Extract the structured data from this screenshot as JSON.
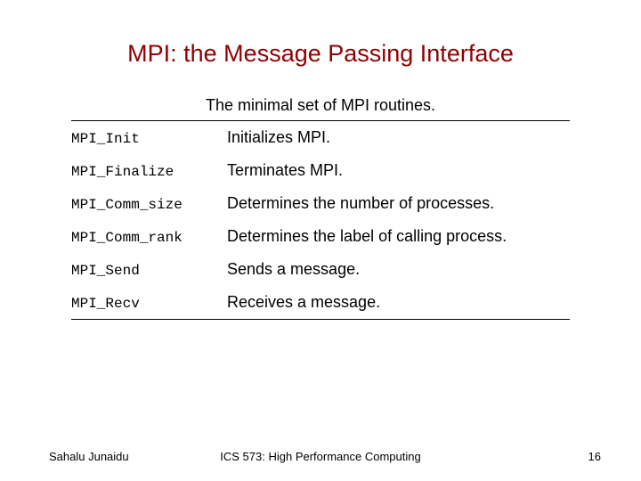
{
  "title": "MPI: the Message Passing Interface",
  "subtitle": "The minimal set of MPI routines.",
  "routines": [
    {
      "name": "MPI_Init",
      "desc": "Initializes MPI."
    },
    {
      "name": "MPI_Finalize",
      "desc": "Terminates MPI."
    },
    {
      "name": "MPI_Comm_size",
      "desc": "Determines the number of processes."
    },
    {
      "name": "MPI_Comm_rank",
      "desc": "Determines the label of calling process."
    },
    {
      "name": "MPI_Send",
      "desc": "Sends a message."
    },
    {
      "name": "MPI_Recv",
      "desc": "Receives a message."
    }
  ],
  "footer": {
    "author": "Sahalu Junaidu",
    "course": "ICS 573: High Performance Computing",
    "page": "16"
  }
}
